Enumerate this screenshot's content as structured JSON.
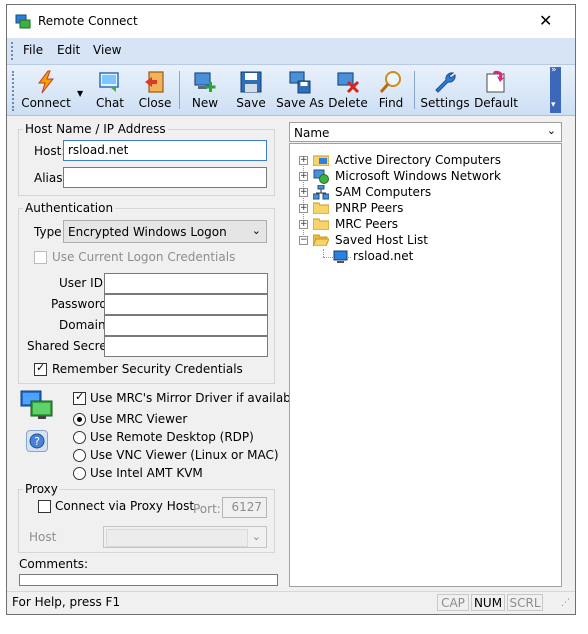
{
  "window": {
    "title": "Remote Connect",
    "close_glyph": "✕"
  },
  "menu": {
    "items": [
      "File",
      "Edit",
      "View"
    ]
  },
  "toolbar": {
    "buttons": [
      {
        "label": "Connect",
        "icon": "lightning-icon"
      },
      {
        "label": "Chat",
        "icon": "chat-icon"
      },
      {
        "label": "Close",
        "icon": "exit-door-icon"
      },
      {
        "label": "New",
        "icon": "new-computer-icon"
      },
      {
        "label": "Save",
        "icon": "floppy-disk-icon"
      },
      {
        "label": "Save As",
        "icon": "save-as-computer-icon"
      },
      {
        "label": "Delete",
        "icon": "delete-computer-icon"
      },
      {
        "label": "Find",
        "icon": "magnifier-icon"
      },
      {
        "label": "Settings",
        "icon": "wrench-icon"
      },
      {
        "label": "Default",
        "icon": "default-return-icon"
      }
    ]
  },
  "host": {
    "group_label": "Host Name / IP Address",
    "host_label": "Host:",
    "host_value": "rsload.net",
    "alias_label": "Alias:",
    "alias_value": ""
  },
  "auth": {
    "group_label": "Authentication",
    "type_label": "Type:",
    "type_value": "Encrypted Windows Logon",
    "use_current_label": "Use Current Logon Credentials",
    "user_id_label": "User ID:",
    "password_label": "Password:",
    "domain_label": "Domain:",
    "shared_secret_label": "Shared Secret:",
    "remember_label": "Remember Security Credentials",
    "remember_checked": true
  },
  "viewer": {
    "mirror_label": "Use MRC's Mirror Driver if available",
    "mirror_checked": true,
    "options": [
      "Use MRC Viewer",
      "Use Remote Desktop (RDP)",
      "Use VNC Viewer (Linux or MAC)",
      "Use Intel AMT KVM"
    ],
    "selected": "Use MRC Viewer"
  },
  "proxy": {
    "group_label": "Proxy",
    "connect_label": "Connect via Proxy Host",
    "port_label": "Port:",
    "port_value": "6127",
    "host_label": "Host",
    "host_value": ""
  },
  "comments": {
    "label": "Comments:",
    "value": ""
  },
  "tree": {
    "header": "Name",
    "nodes": [
      {
        "label": "Active Directory Computers",
        "icon": "active-directory-icon"
      },
      {
        "label": "Microsoft Windows Network",
        "icon": "network-globe-icon"
      },
      {
        "label": "SAM Computers",
        "icon": "sam-network-icon"
      },
      {
        "label": "PNRP Peers",
        "icon": "folder-icon"
      },
      {
        "label": "MRC Peers",
        "icon": "folder-icon"
      },
      {
        "label": "Saved Host List",
        "icon": "open-folder-icon"
      }
    ],
    "child": {
      "label": "rsload.net",
      "icon": "computer-icon"
    }
  },
  "status": {
    "help": "For Help, press F1",
    "cap": "CAP",
    "num": "NUM",
    "scrl": "SCRL"
  },
  "colors": {
    "accent": "#1f5fbf",
    "menubar": "#d6e4f5",
    "toolbar": "#cddff4"
  }
}
